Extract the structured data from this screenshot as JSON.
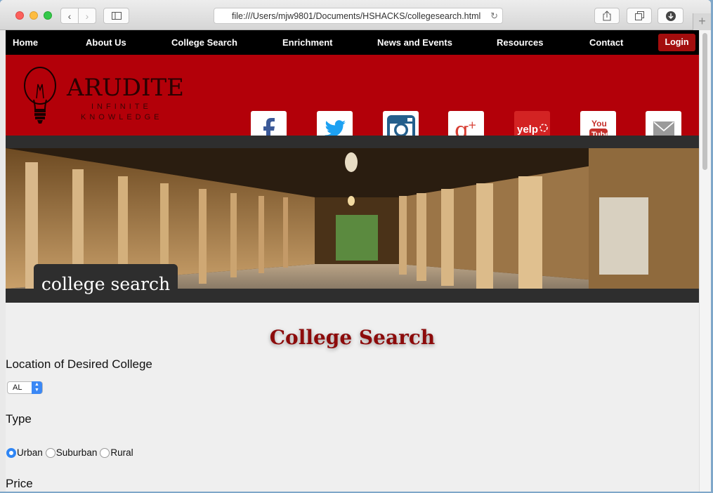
{
  "browser": {
    "url": "file:///Users/mjw9801/Documents/HSHACKS/collegesearch.html"
  },
  "nav": {
    "items": [
      "Home",
      "About Us",
      "College Search",
      "Enrichment",
      "News and Events",
      "Resources",
      "Contact"
    ],
    "login": "Login"
  },
  "logo": {
    "title": "ARUDITE",
    "line1": "INFINITE",
    "line2": "KNOWLEDGE"
  },
  "social": [
    "facebook",
    "twitter",
    "instagram",
    "google-plus",
    "yelp",
    "youtube",
    "email"
  ],
  "banner": {
    "label": "college search"
  },
  "main": {
    "title": "College Search",
    "location_label": "Location of Desired College",
    "location_value": "AL",
    "type_label": "Type",
    "type_options": [
      "Urban",
      "Suburban",
      "Rural"
    ],
    "type_selected": "Urban",
    "price_label": "Price"
  },
  "colors": {
    "brand_red": "#b30009",
    "nav_black": "#000000",
    "title_red": "#8c0b0b",
    "accent_blue": "#2f86f5"
  }
}
